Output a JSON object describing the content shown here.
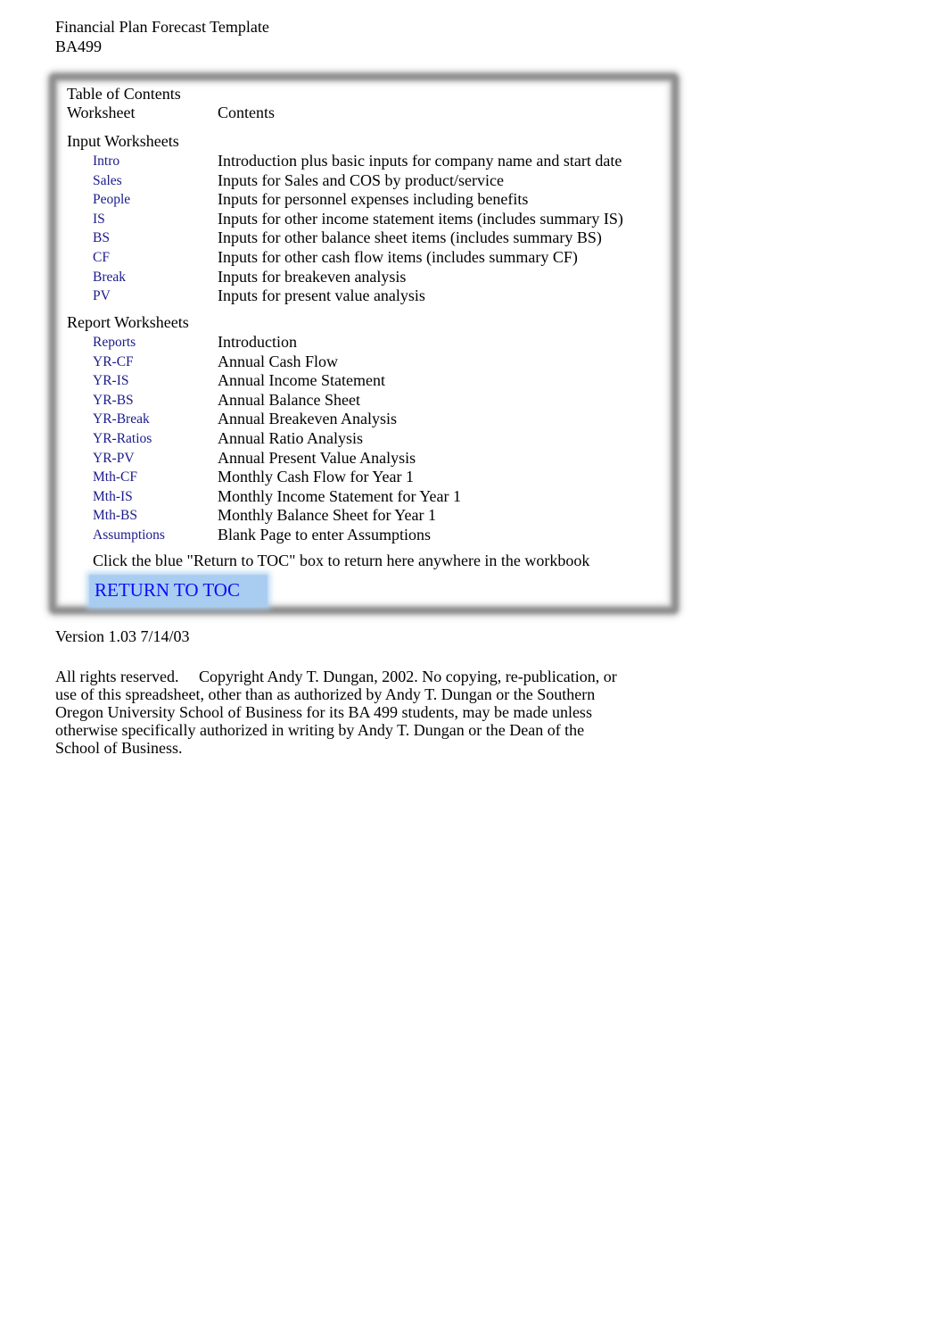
{
  "header": {
    "title": "Financial Plan Forecast Template",
    "course": "BA499"
  },
  "toc": {
    "heading": "Table of Contents",
    "col_worksheet": "Worksheet",
    "col_contents": "Contents",
    "input_section": {
      "label": "Input Worksheets",
      "items": [
        {
          "link": "Intro",
          "desc": "Introduction plus basic inputs for company name and start date"
        },
        {
          "link": "Sales",
          "desc": "Inputs for Sales and COS by product/service"
        },
        {
          "link": "People",
          "desc": "Inputs for personnel expenses including benefits"
        },
        {
          "link": "IS",
          "desc": "Inputs for other income statement items (includes summary IS)"
        },
        {
          "link": "BS",
          "desc": "Inputs for other balance sheet items (includes summary BS)"
        },
        {
          "link": "CF",
          "desc": "Inputs for other cash flow items (includes summary CF)"
        },
        {
          "link": "Break",
          "desc": "Inputs for breakeven analysis"
        },
        {
          "link": "PV",
          "desc": "Inputs for present value analysis"
        }
      ]
    },
    "report_section": {
      "label": "Report Worksheets",
      "items": [
        {
          "link": "Reports",
          "desc": "Introduction"
        },
        {
          "link": "YR-CF",
          "desc": "Annual Cash Flow"
        },
        {
          "link": "YR-IS",
          "desc": "Annual Income Statement"
        },
        {
          "link": "YR-BS",
          "desc": "Annual Balance Sheet"
        },
        {
          "link": "YR-Break",
          "desc": "Annual Breakeven Analysis"
        },
        {
          "link": "YR-Ratios",
          "desc": "Annual Ratio Analysis"
        },
        {
          "link": "YR-PV",
          "desc": "Annual Present Value Analysis"
        },
        {
          "link": "Mth-CF",
          "desc": "Monthly Cash Flow for Year 1"
        },
        {
          "link": "Mth-IS",
          "desc": "Monthly Income Statement for Year 1"
        },
        {
          "link": "Mth-BS",
          "desc": "Monthly Balance Sheet for Year 1"
        },
        {
          "link": "Assumptions",
          "desc": "Blank Page to enter Assumptions"
        }
      ]
    },
    "instruction": "Click the blue \"Return to TOC\" box to return here anywhere in the workbook",
    "return_button": "RETURN TO TOC"
  },
  "footer": {
    "version": "Version 1.03 7/14/03",
    "copyright": "All rights reserved.     Copyright Andy T. Dungan, 2002. No copying, re-publication, or use of this spreadsheet, other than as authorized by Andy T. Dungan or the Southern Oregon University School of Business for its BA 499 students, may be made unless otherwise specifically authorized in writing by Andy T. Dungan or the Dean of the School of Business."
  },
  "colors": {
    "link": "#1a1a8c",
    "return_button_bg": "#a8cdf0",
    "return_button_text": "#0a0aff",
    "frame": "#8f8f8f"
  }
}
